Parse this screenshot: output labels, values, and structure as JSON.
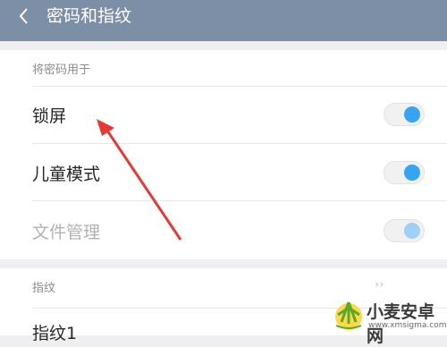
{
  "header": {
    "title": "密码和指纹",
    "back_icon": "chevron-left-icon"
  },
  "password_section": {
    "header": "将密码用于",
    "items": [
      {
        "label": "锁屏",
        "enabled": true,
        "disabled": false
      },
      {
        "label": "儿童模式",
        "enabled": true,
        "disabled": false
      },
      {
        "label": "文件管理",
        "enabled": true,
        "disabled": true
      }
    ]
  },
  "fingerprint_section": {
    "header": "指纹",
    "items": [
      {
        "label": "指纹1"
      }
    ]
  },
  "annotation": {
    "arrow_color": "#e53935"
  },
  "watermark": {
    "text": "小麦安卓网",
    "url": "www.xmsigma.com"
  }
}
